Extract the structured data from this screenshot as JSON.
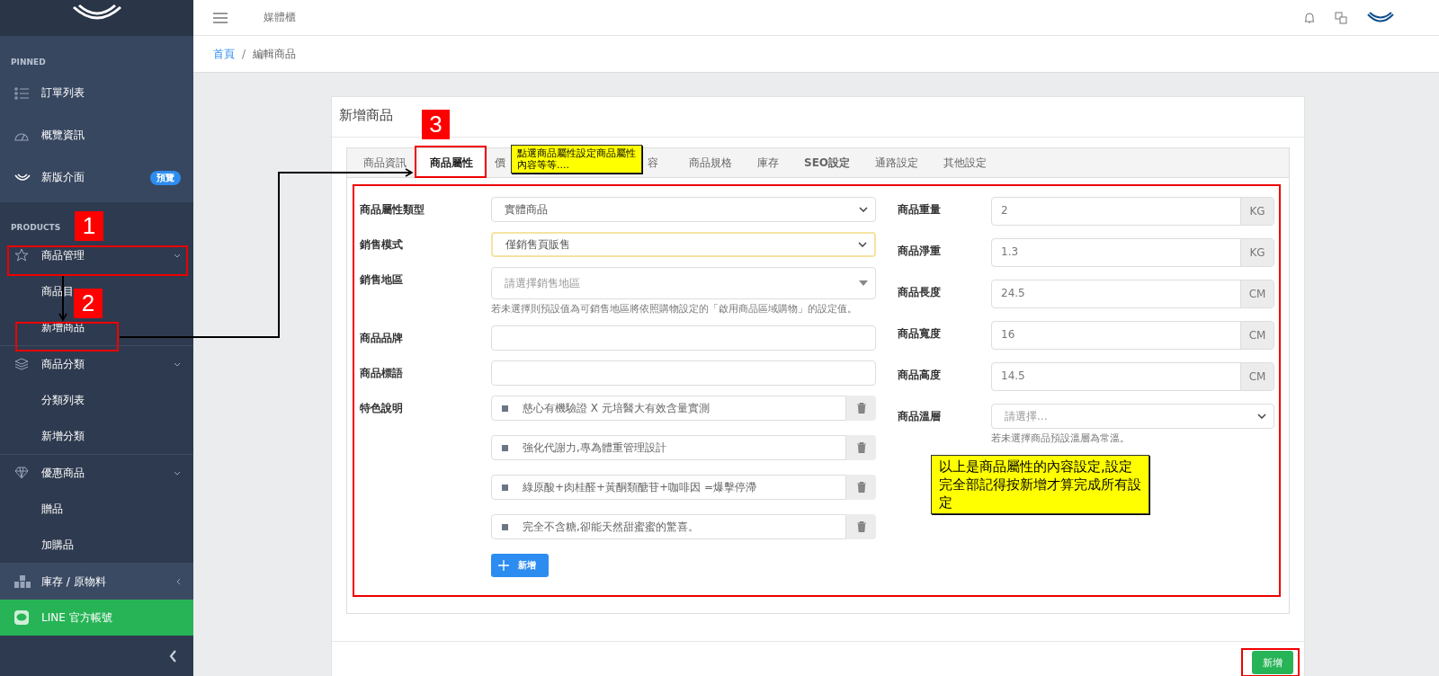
{
  "topbar": {
    "title": "媒體櫃"
  },
  "breadcrumb": {
    "separator": "/",
    "items": [
      {
        "label": "首頁",
        "link": true
      },
      {
        "label": "編輯商品",
        "link": false
      }
    ]
  },
  "sidebar": {
    "sections": [
      {
        "heading": "PINNED",
        "items": [
          {
            "label": "訂單列表",
            "kind": "pinned"
          },
          {
            "label": "概覽資訊",
            "kind": "pinned"
          },
          {
            "label": "新版介面",
            "kind": "pinned",
            "badge": "預覽"
          }
        ]
      },
      {
        "heading": "PRODUCTS",
        "items": [
          {
            "label": "商品管理",
            "kind": "group",
            "expanded": true,
            "children": [
              {
                "label": "商品目"
              },
              {
                "label": "新增商品"
              }
            ]
          },
          {
            "label": "商品分類",
            "kind": "group",
            "expanded": true,
            "children": [
              {
                "label": "分類列表"
              },
              {
                "label": "新增分類"
              }
            ]
          },
          {
            "label": "優惠商品",
            "kind": "group",
            "expanded": true,
            "children": [
              {
                "label": "贈品"
              },
              {
                "label": "加購品"
              }
            ]
          },
          {
            "label": "庫存 / 原物料",
            "kind": "hovered",
            "expanded": false
          },
          {
            "label": "LINE 官方帳號",
            "kind": "promo"
          }
        ]
      }
    ]
  },
  "card": {
    "title": "新增商品",
    "tabs": [
      {
        "label": "商品資訊",
        "selected": false
      },
      {
        "label": "商品屬性",
        "selected": true
      },
      {
        "label": "價",
        "selected": false
      },
      {
        "label": "容",
        "selected": false
      },
      {
        "label": "商品規格",
        "selected": false
      },
      {
        "label": "庫存",
        "selected": false
      },
      {
        "label": "SEO設定",
        "selected": false
      },
      {
        "label": "通路設定",
        "selected": false
      },
      {
        "label": "其他設定",
        "selected": false
      }
    ],
    "left_fields": [
      {
        "label": "商品屬性類型",
        "kind": "select",
        "value": "實體商品",
        "focused": false
      },
      {
        "label": "銷售模式",
        "kind": "select",
        "value": "僅銷售頁販售",
        "focused": true
      },
      {
        "label": "銷售地區",
        "kind": "multiselect",
        "placeholder": "請選擇銷售地區",
        "help": "若未選擇則預設值為可銷售地區將依照購物設定的「啟用商品區域購物」的設定值。"
      },
      {
        "label": "商品品牌",
        "kind": "input"
      },
      {
        "label": "商品標語",
        "kind": "input"
      },
      {
        "label": "特色說明",
        "kind": "features",
        "items": [
          "慈心有機驗證 X 元培醫大有效含量實測",
          "強化代謝力,專為體重管理設計",
          "綠原酸+肉桂醛+黃酮類醣苷+咖啡因 =爆擊停滯",
          "完全不含糖,卻能天然甜蜜蜜的驚喜。"
        ],
        "add_button": "新增"
      }
    ],
    "right_fields": [
      {
        "label": "商品重量",
        "kind": "unit",
        "value": "2",
        "unit": "KG"
      },
      {
        "label": "商品淨重",
        "kind": "unit",
        "value": "1.3",
        "unit": "KG"
      },
      {
        "label": "商品長度",
        "kind": "unit",
        "value": "24.5",
        "unit": "CM"
      },
      {
        "label": "商品寬度",
        "kind": "unit",
        "value": "16",
        "unit": "CM"
      },
      {
        "label": "商品高度",
        "kind": "unit",
        "value": "14.5",
        "unit": "CM"
      },
      {
        "label": "商品溫層",
        "kind": "select",
        "placeholder": "請選擇...",
        "help": "若未選擇商品預設溫層為常溫。"
      }
    ],
    "submit_button": "新增"
  },
  "annotations": {
    "markers": [
      "1",
      "2",
      "3"
    ],
    "notes": [
      "點選商品屬性設定商品屬性內容等等....",
      "以上是商品屬性的內容設定,設定完全部記得按新增才算完成所有設定"
    ]
  }
}
